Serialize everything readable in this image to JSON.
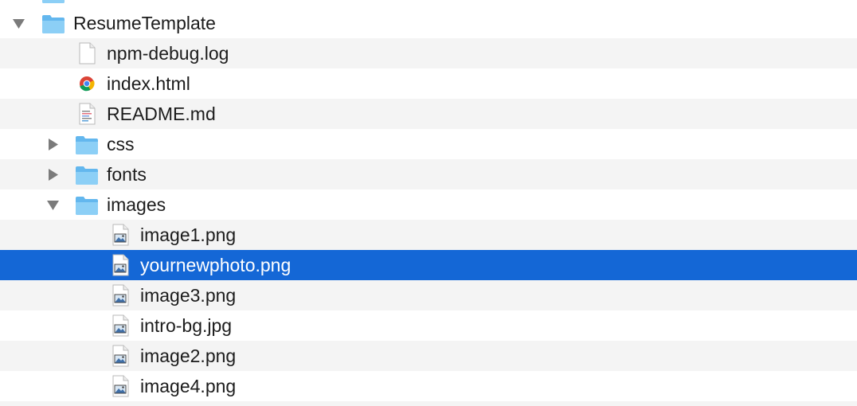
{
  "window": {
    "view": "list"
  },
  "tree": {
    "partial_row": {
      "label": "",
      "icon": "folder-icon"
    },
    "root": {
      "label": "ResumeTemplate",
      "icon": "folder-icon",
      "expanded": true
    },
    "files": [
      {
        "label": "npm-debug.log",
        "icon": "document-icon"
      },
      {
        "label": "index.html",
        "icon": "chrome-html-icon"
      },
      {
        "label": "README.md",
        "icon": "text-document-icon"
      }
    ],
    "folders": [
      {
        "label": "css",
        "icon": "folder-icon",
        "expanded": false
      },
      {
        "label": "fonts",
        "icon": "folder-icon",
        "expanded": false
      },
      {
        "label": "images",
        "icon": "folder-icon",
        "expanded": true
      }
    ],
    "images": [
      {
        "label": "image1.png",
        "icon": "image-file-icon",
        "selected": false
      },
      {
        "label": "yournewphoto.png",
        "icon": "image-file-icon",
        "selected": true
      },
      {
        "label": "image3.png",
        "icon": "image-file-icon",
        "selected": false
      },
      {
        "label": "intro-bg.jpg",
        "icon": "image-file-icon",
        "selected": false
      },
      {
        "label": "image2.png",
        "icon": "image-file-icon",
        "selected": false
      },
      {
        "label": "image4.png",
        "icon": "image-file-icon",
        "selected": false
      }
    ]
  },
  "colors": {
    "selection": "#1467d6",
    "stripe": "#f4f4f4",
    "folder": "#63b7ee",
    "text": "#1c1c1c"
  }
}
